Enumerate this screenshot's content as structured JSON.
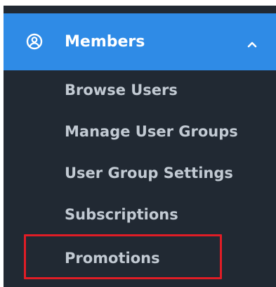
{
  "menu": {
    "section_label": "Members",
    "section_icon": "user-circle-icon",
    "expand_icon": "chevron-up-icon",
    "items": [
      {
        "label": "Browse Users"
      },
      {
        "label": "Manage User Groups"
      },
      {
        "label": "User Group Settings"
      },
      {
        "label": "Subscriptions"
      },
      {
        "label": "Promotions",
        "highlighted": true
      }
    ]
  },
  "colors": {
    "panel_bg": "#212933",
    "header_bg": "#2f8be6",
    "item_text": "#c2cad3",
    "highlight_border": "#e01d26"
  }
}
